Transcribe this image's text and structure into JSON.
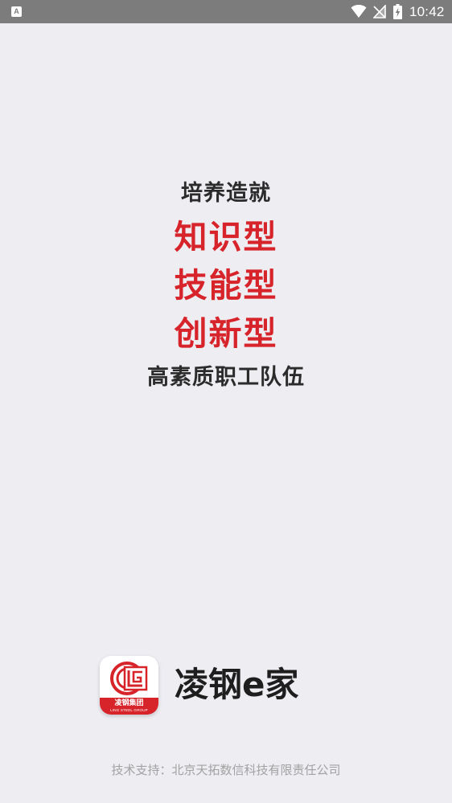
{
  "status_bar": {
    "app_icon_letter": "A",
    "time": "10:42",
    "icons": [
      "wifi-icon",
      "no-signal-icon",
      "battery-charging-icon"
    ]
  },
  "slogan": {
    "line1": "培养造就",
    "line2": "知识型",
    "line3": "技能型",
    "line4": "创新型",
    "line5": "高素质职工队伍",
    "accent_color": "#d7232a",
    "text_color": "#2b2b2b"
  },
  "logo": {
    "band_text_cn": "凌钢集团",
    "band_text_en": "LING STEEL GROUP",
    "brand_name": "凌钢e家"
  },
  "footer": {
    "text": "技术支持：北京天拓数信科技有限责任公司"
  }
}
